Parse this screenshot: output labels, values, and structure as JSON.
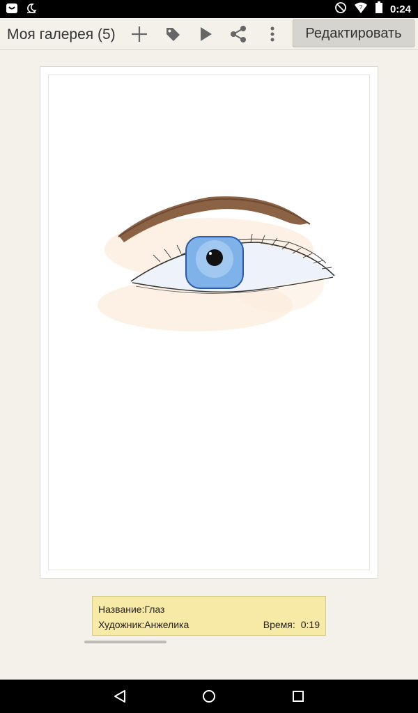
{
  "status_bar": {
    "time": "0:24",
    "icons": [
      "notification-icon",
      "moon-icon",
      "dnd-icon",
      "wifi-icon",
      "battery-icon"
    ]
  },
  "action_bar": {
    "title": "Моя галерея (5)",
    "actions": [
      "add-icon",
      "tag-icon",
      "play-icon",
      "share-icon",
      "overflow-menu-icon"
    ],
    "edit_label": "Редактировать"
  },
  "artwork": {
    "subject": "eye-drawing"
  },
  "info": {
    "title_label": "Название:",
    "title_value": "Глаз",
    "artist_label": "Художник:",
    "artist_value": "Анжелика",
    "time_label": "Время:",
    "time_value": "0:19"
  },
  "nav_bar": {
    "buttons": [
      "back-icon",
      "home-icon",
      "recents-icon"
    ]
  },
  "colors": {
    "background": "#f4f1ea",
    "info_panel": "#f7e9a6",
    "iris": "#7fb2e8"
  }
}
